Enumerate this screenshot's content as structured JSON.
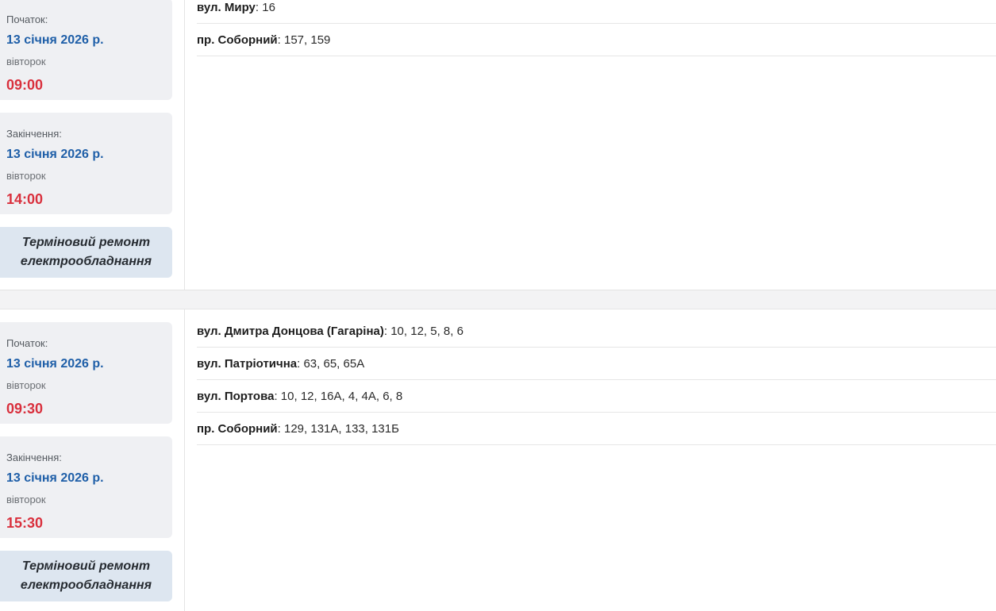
{
  "outages": [
    {
      "start": {
        "label": "Початок:",
        "date": "13 січня 2026 р.",
        "weekday": "вівторок",
        "time": "09:00"
      },
      "end": {
        "label": "Закінчення:",
        "date": "13 січня 2026 р.",
        "weekday": "вівторок",
        "time": "14:00"
      },
      "reason_line1": "Терміновий ремонт",
      "reason_line2": "електрообладнання",
      "addresses": [
        {
          "street": "вул. Миру",
          "houses": "16"
        },
        {
          "street": "пр. Соборний",
          "houses": "157, 159"
        }
      ]
    },
    {
      "start": {
        "label": "Початок:",
        "date": "13 січня 2026 р.",
        "weekday": "вівторок",
        "time": "09:30"
      },
      "end": {
        "label": "Закінчення:",
        "date": "13 січня 2026 р.",
        "weekday": "вівторок",
        "time": "15:30"
      },
      "reason_line1": "Терміновий ремонт",
      "reason_line2": "електрообладнання",
      "addresses": [
        {
          "street": "вул. Дмитра Донцова (Гагаріна)",
          "houses": "10, 12, 5, 8, 6"
        },
        {
          "street": "вул. Патріотична",
          "houses": "63, 65, 65А"
        },
        {
          "street": "вул. Портова",
          "houses": "10, 12, 16А, 4, 4А, 6, 8"
        },
        {
          "street": "пр. Соборний",
          "houses": "129, 131А, 133, 131Б"
        }
      ]
    }
  ],
  "colors": {
    "date": "#1f5fa8",
    "time": "#d9303d",
    "block_bg": "#eff0f3",
    "reason_bg": "#dde6f0"
  }
}
